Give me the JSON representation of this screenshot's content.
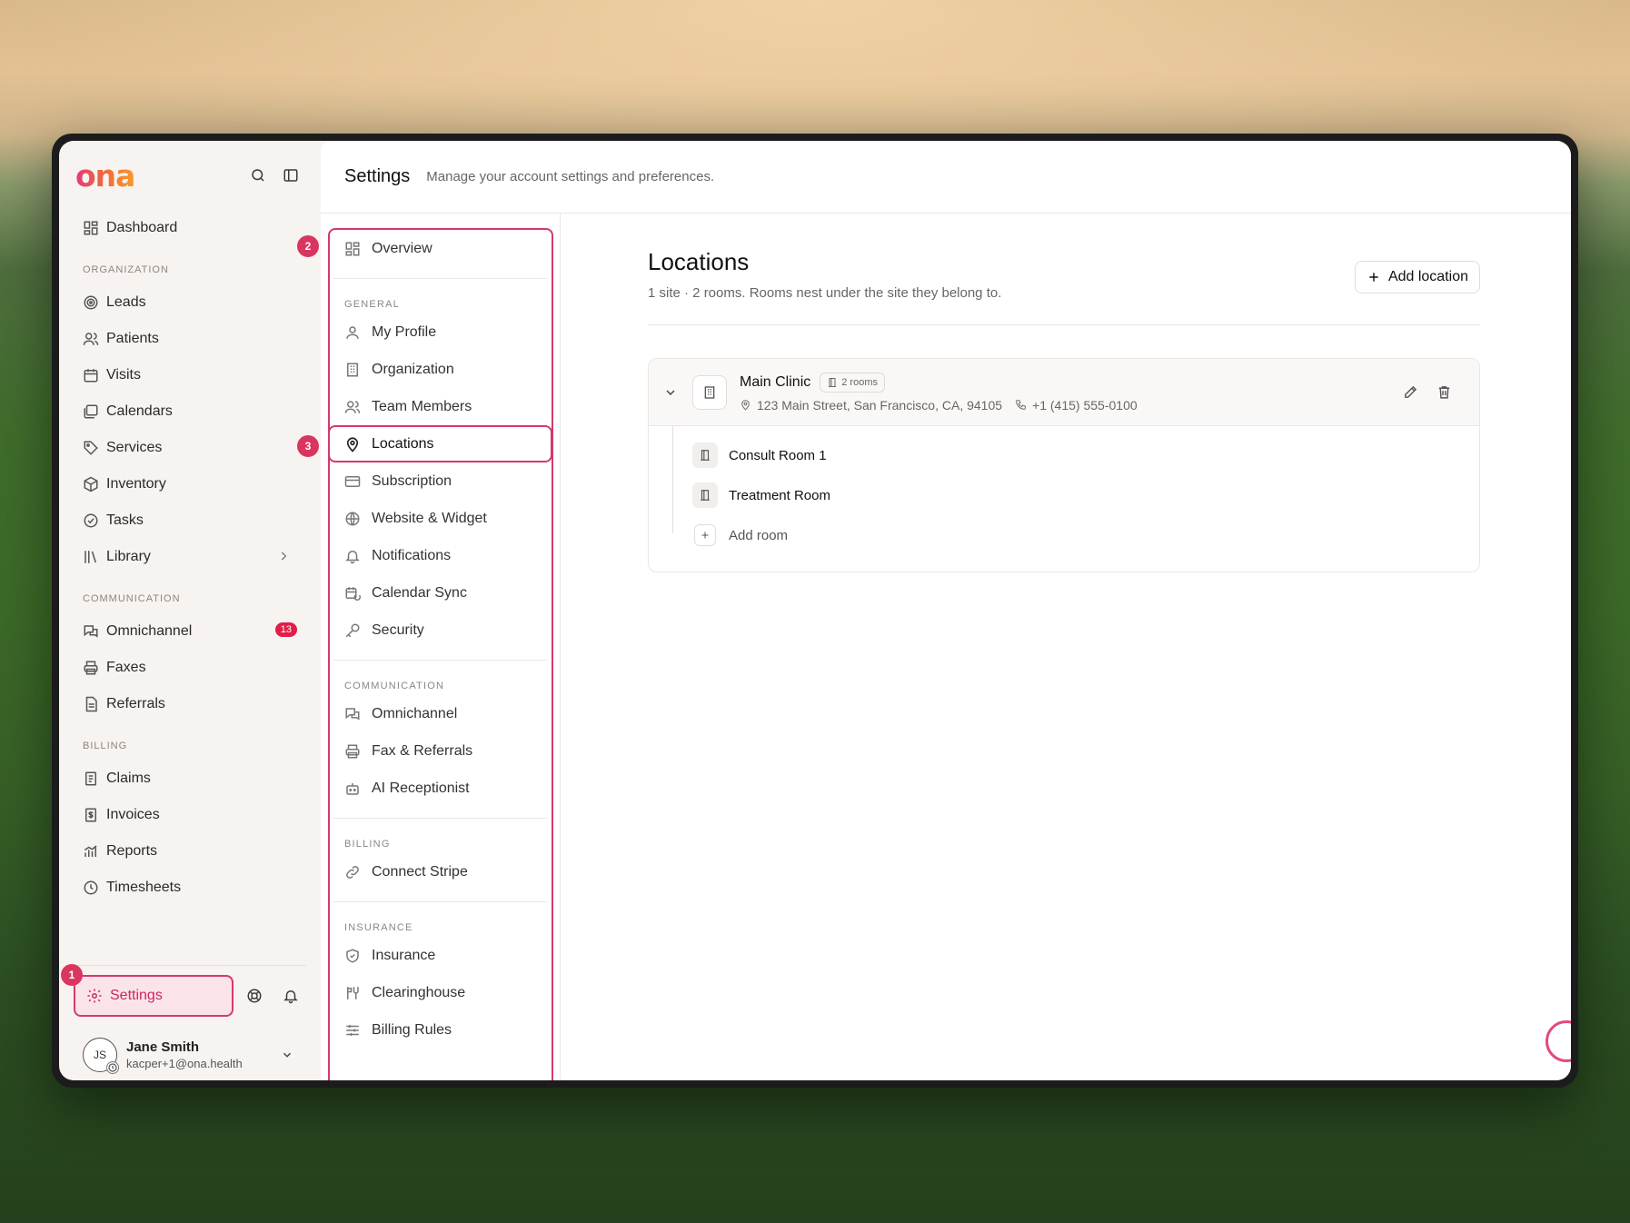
{
  "brand": {
    "logo_text": "ona",
    "accent": "#d33a6b",
    "logo_gradient": [
      "#e23a7b",
      "#f79a2b"
    ]
  },
  "sidebar": {
    "dashboard": "Dashboard",
    "sections": {
      "organization": "ORGANIZATION",
      "communication": "COMMUNICATION",
      "billing": "BILLING"
    },
    "organization_items": [
      "Leads",
      "Patients",
      "Visits",
      "Calendars",
      "Services",
      "Inventory",
      "Tasks",
      "Library"
    ],
    "communication_items": [
      "Omnichannel",
      "Faxes",
      "Referrals"
    ],
    "omnichannel_badge": "13",
    "billing_items": [
      "Claims",
      "Invoices",
      "Reports",
      "Timesheets"
    ],
    "settings_label": "Settings",
    "user": {
      "initials": "JS",
      "name": "Jane Smith",
      "email": "kacper+1@ona.health"
    }
  },
  "markers": {
    "m1": "1",
    "m2": "2",
    "m3": "3"
  },
  "header": {
    "title": "Settings",
    "subtitle": "Manage your account settings and preferences."
  },
  "settings_nav": {
    "overview": "Overview",
    "general_section": "GENERAL",
    "general_items": [
      "My Profile",
      "Organization",
      "Team Members",
      "Locations",
      "Subscription",
      "Website & Widget",
      "Notifications",
      "Calendar Sync",
      "Security"
    ],
    "communication_section": "COMMUNICATION",
    "communication_items": [
      "Omnichannel",
      "Fax & Referrals",
      "AI Receptionist"
    ],
    "billing_section": "BILLING",
    "billing_items": [
      "Connect Stripe"
    ],
    "insurance_section": "INSURANCE",
    "insurance_items": [
      "Insurance",
      "Clearinghouse",
      "Billing Rules"
    ]
  },
  "locations": {
    "title": "Locations",
    "subtitle": "1 site · 2 rooms. Rooms nest under the site they belong to.",
    "add_button": "Add location",
    "site": {
      "name": "Main Clinic",
      "rooms_badge": "2 rooms",
      "address": "123 Main Street, San Francisco, CA, 94105",
      "phone": "+1 (415) 555-0100",
      "rooms": [
        "Consult Room 1",
        "Treatment Room"
      ],
      "add_room": "Add room"
    }
  }
}
